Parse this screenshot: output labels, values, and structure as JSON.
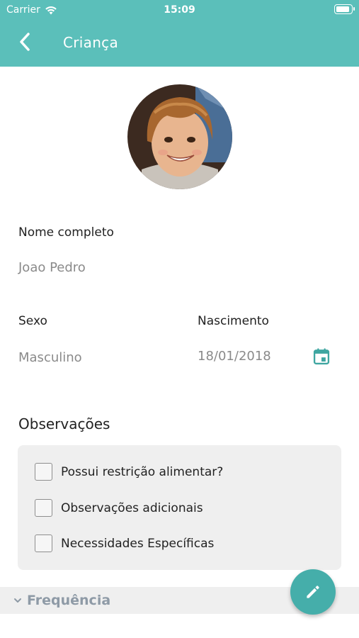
{
  "status_bar": {
    "carrier": "Carrier",
    "time": "15:09"
  },
  "header": {
    "title": "Criança",
    "back_icon": "chevron-left-icon"
  },
  "profile": {
    "photo_icon": "child-photo"
  },
  "fields": {
    "full_name_label": "Nome completo",
    "full_name_value": "Joao Pedro",
    "sex_label": "Sexo",
    "sex_value": "Masculino",
    "birth_label": "Nascimento",
    "birth_value": "18/01/2018",
    "calendar_icon": "calendar-icon"
  },
  "observations": {
    "title": "Observações",
    "items": [
      {
        "label": "Possui restrição alimentar?",
        "checked": false
      },
      {
        "label": "Observações adicionais",
        "checked": false
      },
      {
        "label": "Necessidades Específicas",
        "checked": false
      }
    ]
  },
  "frequency": {
    "label": "Frequência",
    "icon": "chevron-down-icon"
  },
  "fab": {
    "icon": "pencil-icon"
  },
  "colors": {
    "accent": "#5bbfba",
    "fab": "#45aeaa",
    "icon_teal": "#3fa6a1",
    "muted_text": "#8a8a8a",
    "panel_bg": "#efefef"
  }
}
